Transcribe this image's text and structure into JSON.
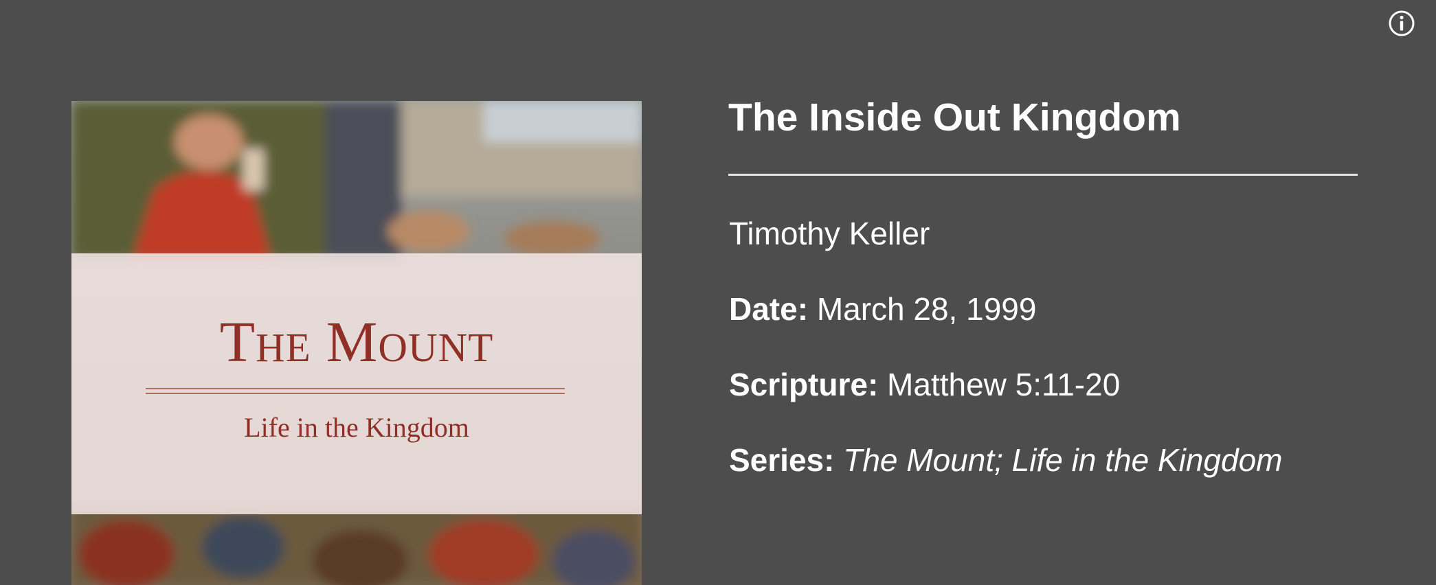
{
  "info_button": {
    "icon": "info-icon"
  },
  "artwork": {
    "title": "The Mount",
    "subtitle": "Life in the Kingdom"
  },
  "sermon": {
    "title": "The Inside Out Kingdom",
    "speaker": "Timothy Keller",
    "date_label": "Date:",
    "date": "March 28, 1999",
    "scripture_label": "Scripture:",
    "scripture": "Matthew 5:11-20",
    "series_label": "Series:",
    "series": "The Mount; Life in the Kingdom"
  },
  "colors": {
    "background": "#4d4d4d",
    "text": "#ffffff",
    "artwork_title": "#8f2f26"
  }
}
